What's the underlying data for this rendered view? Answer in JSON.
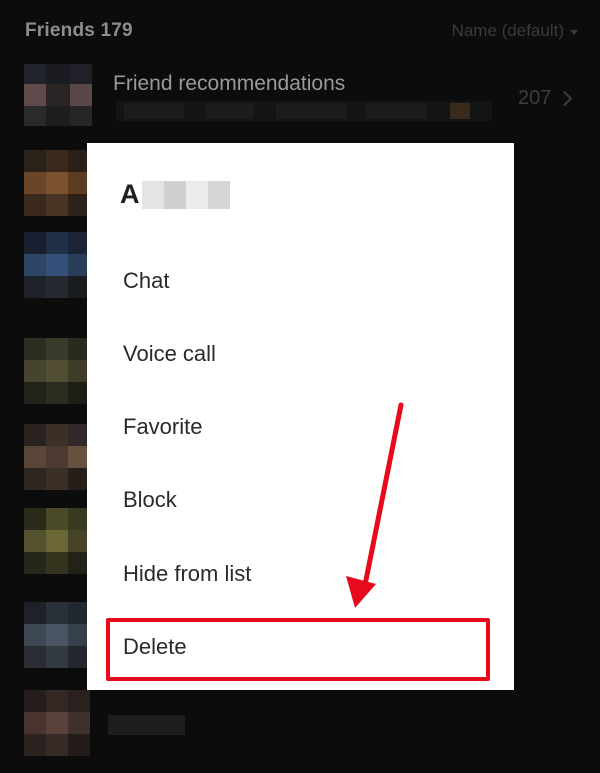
{
  "header": {
    "title": "Friends 179",
    "sort_label": "Name (default)"
  },
  "recommendations": {
    "label": "Friend recommendations",
    "count": "207"
  },
  "dialog": {
    "title_initial": "A",
    "menu": [
      {
        "label": "Chat"
      },
      {
        "label": "Voice call"
      },
      {
        "label": "Favorite"
      },
      {
        "label": "Block"
      },
      {
        "label": "Hide from list"
      },
      {
        "label": "Delete"
      }
    ]
  },
  "colors": {
    "background": "#0c0c0c",
    "dialog": "#ffffff",
    "highlight": "#e8091c"
  },
  "icons": [
    "caret-down-icon",
    "chevron-right-icon",
    "arrow-annotation-icon"
  ]
}
